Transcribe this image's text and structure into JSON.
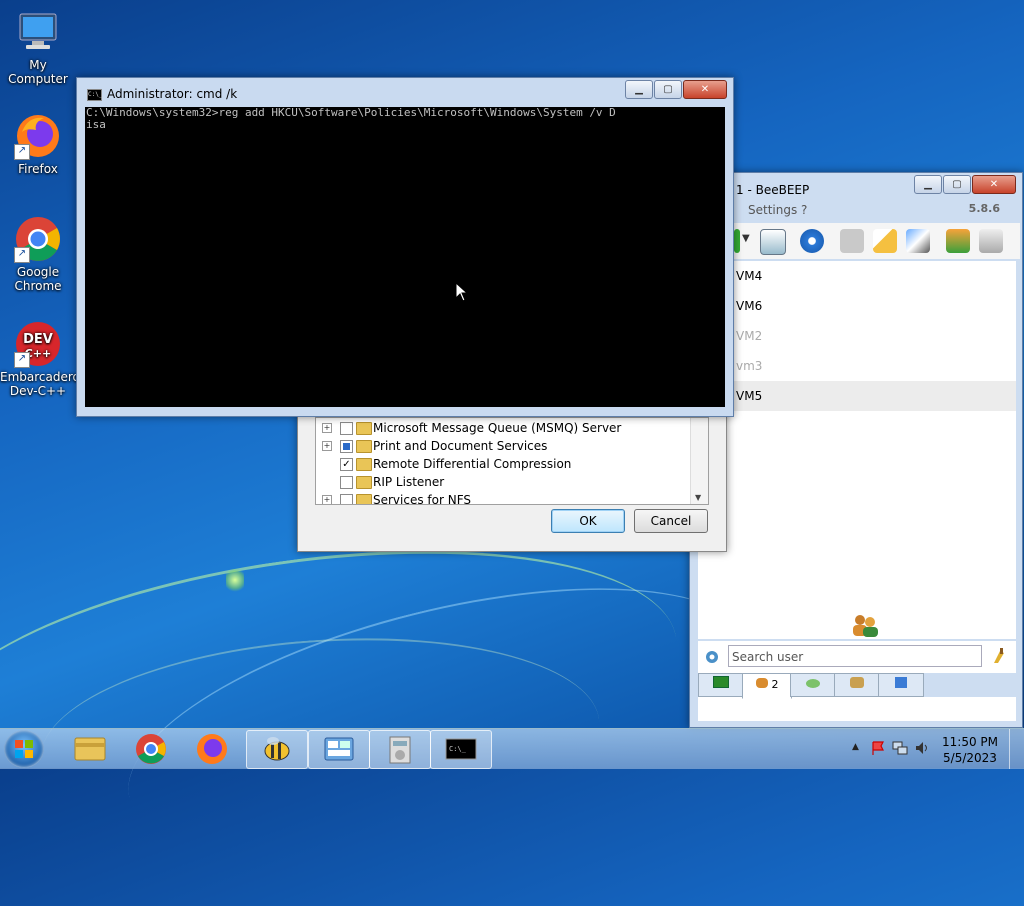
{
  "desktop": {
    "icons": [
      {
        "label": "My Computer",
        "icon": "computer-icon"
      },
      {
        "label": "Firefox",
        "icon": "firefox-icon"
      },
      {
        "label": "Google Chrome",
        "icon": "chrome-icon"
      },
      {
        "label": "Embarcadero Dev-C++",
        "icon": "devcpp-icon"
      }
    ]
  },
  "cmd": {
    "title": "Administrator: cmd  /k",
    "icon_text": "C:\\_",
    "lines": [
      "C:\\Windows\\system32>reg add HKCU\\Software\\Policies\\Microsoft\\Windows\\System /v D",
      "isa"
    ]
  },
  "beebeep": {
    "title": "1 - BeeBEEP",
    "menu": "Settings  ?",
    "version": "5.8.6",
    "users": [
      {
        "name": "VM4",
        "state": "online"
      },
      {
        "name": "VM6",
        "state": "online"
      },
      {
        "name": "VM2",
        "state": "offline"
      },
      {
        "name": "vm3",
        "state": "offline"
      },
      {
        "name": "VM5",
        "state": "selected"
      }
    ],
    "search_placeholder": "Search user",
    "tabs": [
      {
        "icon": "chat-list-icon",
        "label": ""
      },
      {
        "icon": "users-icon",
        "label": "2"
      },
      {
        "icon": "chat-icon",
        "label": ""
      },
      {
        "icon": "groups-icon",
        "label": ""
      },
      {
        "icon": "files-icon",
        "label": ""
      }
    ]
  },
  "features": {
    "items": [
      {
        "label": "Microsoft Message Queue (MSMQ) Server",
        "expandable": true,
        "state": "unchecked"
      },
      {
        "label": "Print and Document Services",
        "expandable": true,
        "state": "partial"
      },
      {
        "label": "Remote Differential Compression",
        "expandable": false,
        "state": "checked"
      },
      {
        "label": "RIP Listener",
        "expandable": false,
        "state": "unchecked"
      },
      {
        "label": "Services for NFS",
        "expandable": true,
        "state": "unchecked"
      }
    ],
    "ok_label": "OK",
    "cancel_label": "Cancel"
  },
  "taskbar": {
    "clock_time": "11:50 PM",
    "clock_date": "5/5/2023",
    "items": [
      "explorer-icon",
      "chrome-icon",
      "firefox-icon",
      "beebeep-icon",
      "control-panel-icon",
      "installer-icon",
      "cmd-icon"
    ]
  }
}
